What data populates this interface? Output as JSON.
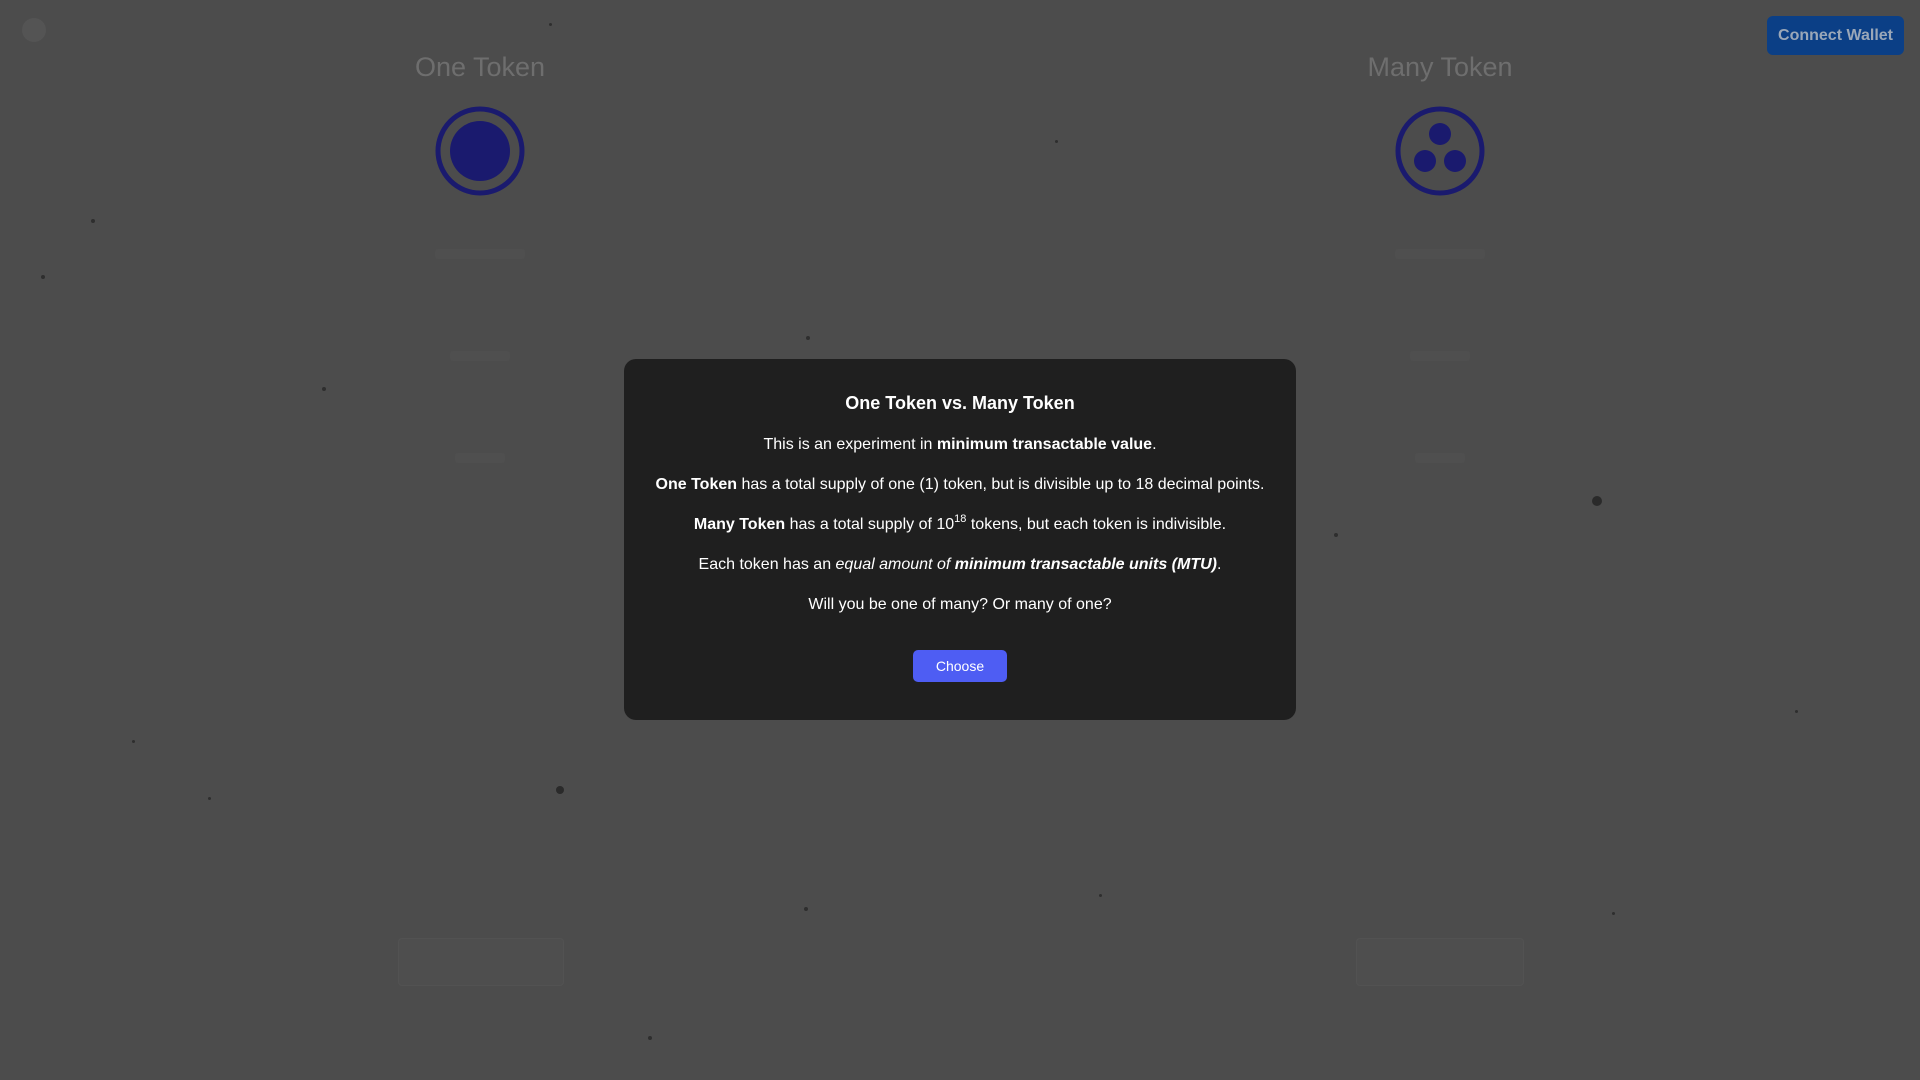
{
  "header": {
    "connect_wallet_label": "Connect Wallet"
  },
  "tokens": {
    "left": {
      "title": "One Token",
      "icon": "single-coin-icon"
    },
    "right": {
      "title": "Many Token",
      "icon": "three-coins-icon"
    }
  },
  "modal": {
    "title": "One Token vs. Many Token",
    "line1_prefix": "This is an experiment in ",
    "line1_strong": "minimum transactable value",
    "line1_suffix": ".",
    "line2_strong": "One Token",
    "line2_rest": " has a total supply of one (1) token, but is divisible up to 18 decimal points.",
    "line3_strong": "Many Token",
    "line3_pre": " has a total supply of 10",
    "line3_sup": "18",
    "line3_post": " tokens, but each token is indivisible.",
    "line4_prefix": "Each token has an ",
    "line4_em": "equal amount of ",
    "line4_em_strong": "minimum transactable units (MTU)",
    "line4_suffix": ".",
    "line5": "Will you be one of many? Or many of one?",
    "choose_label": "Choose"
  },
  "colors": {
    "background": "#4c4c4c",
    "modal_bg": "#1f1f1f",
    "choose_button": "#4e5df3",
    "connect_button": "#0b3f86",
    "token_icon": "#1a1a6e"
  }
}
